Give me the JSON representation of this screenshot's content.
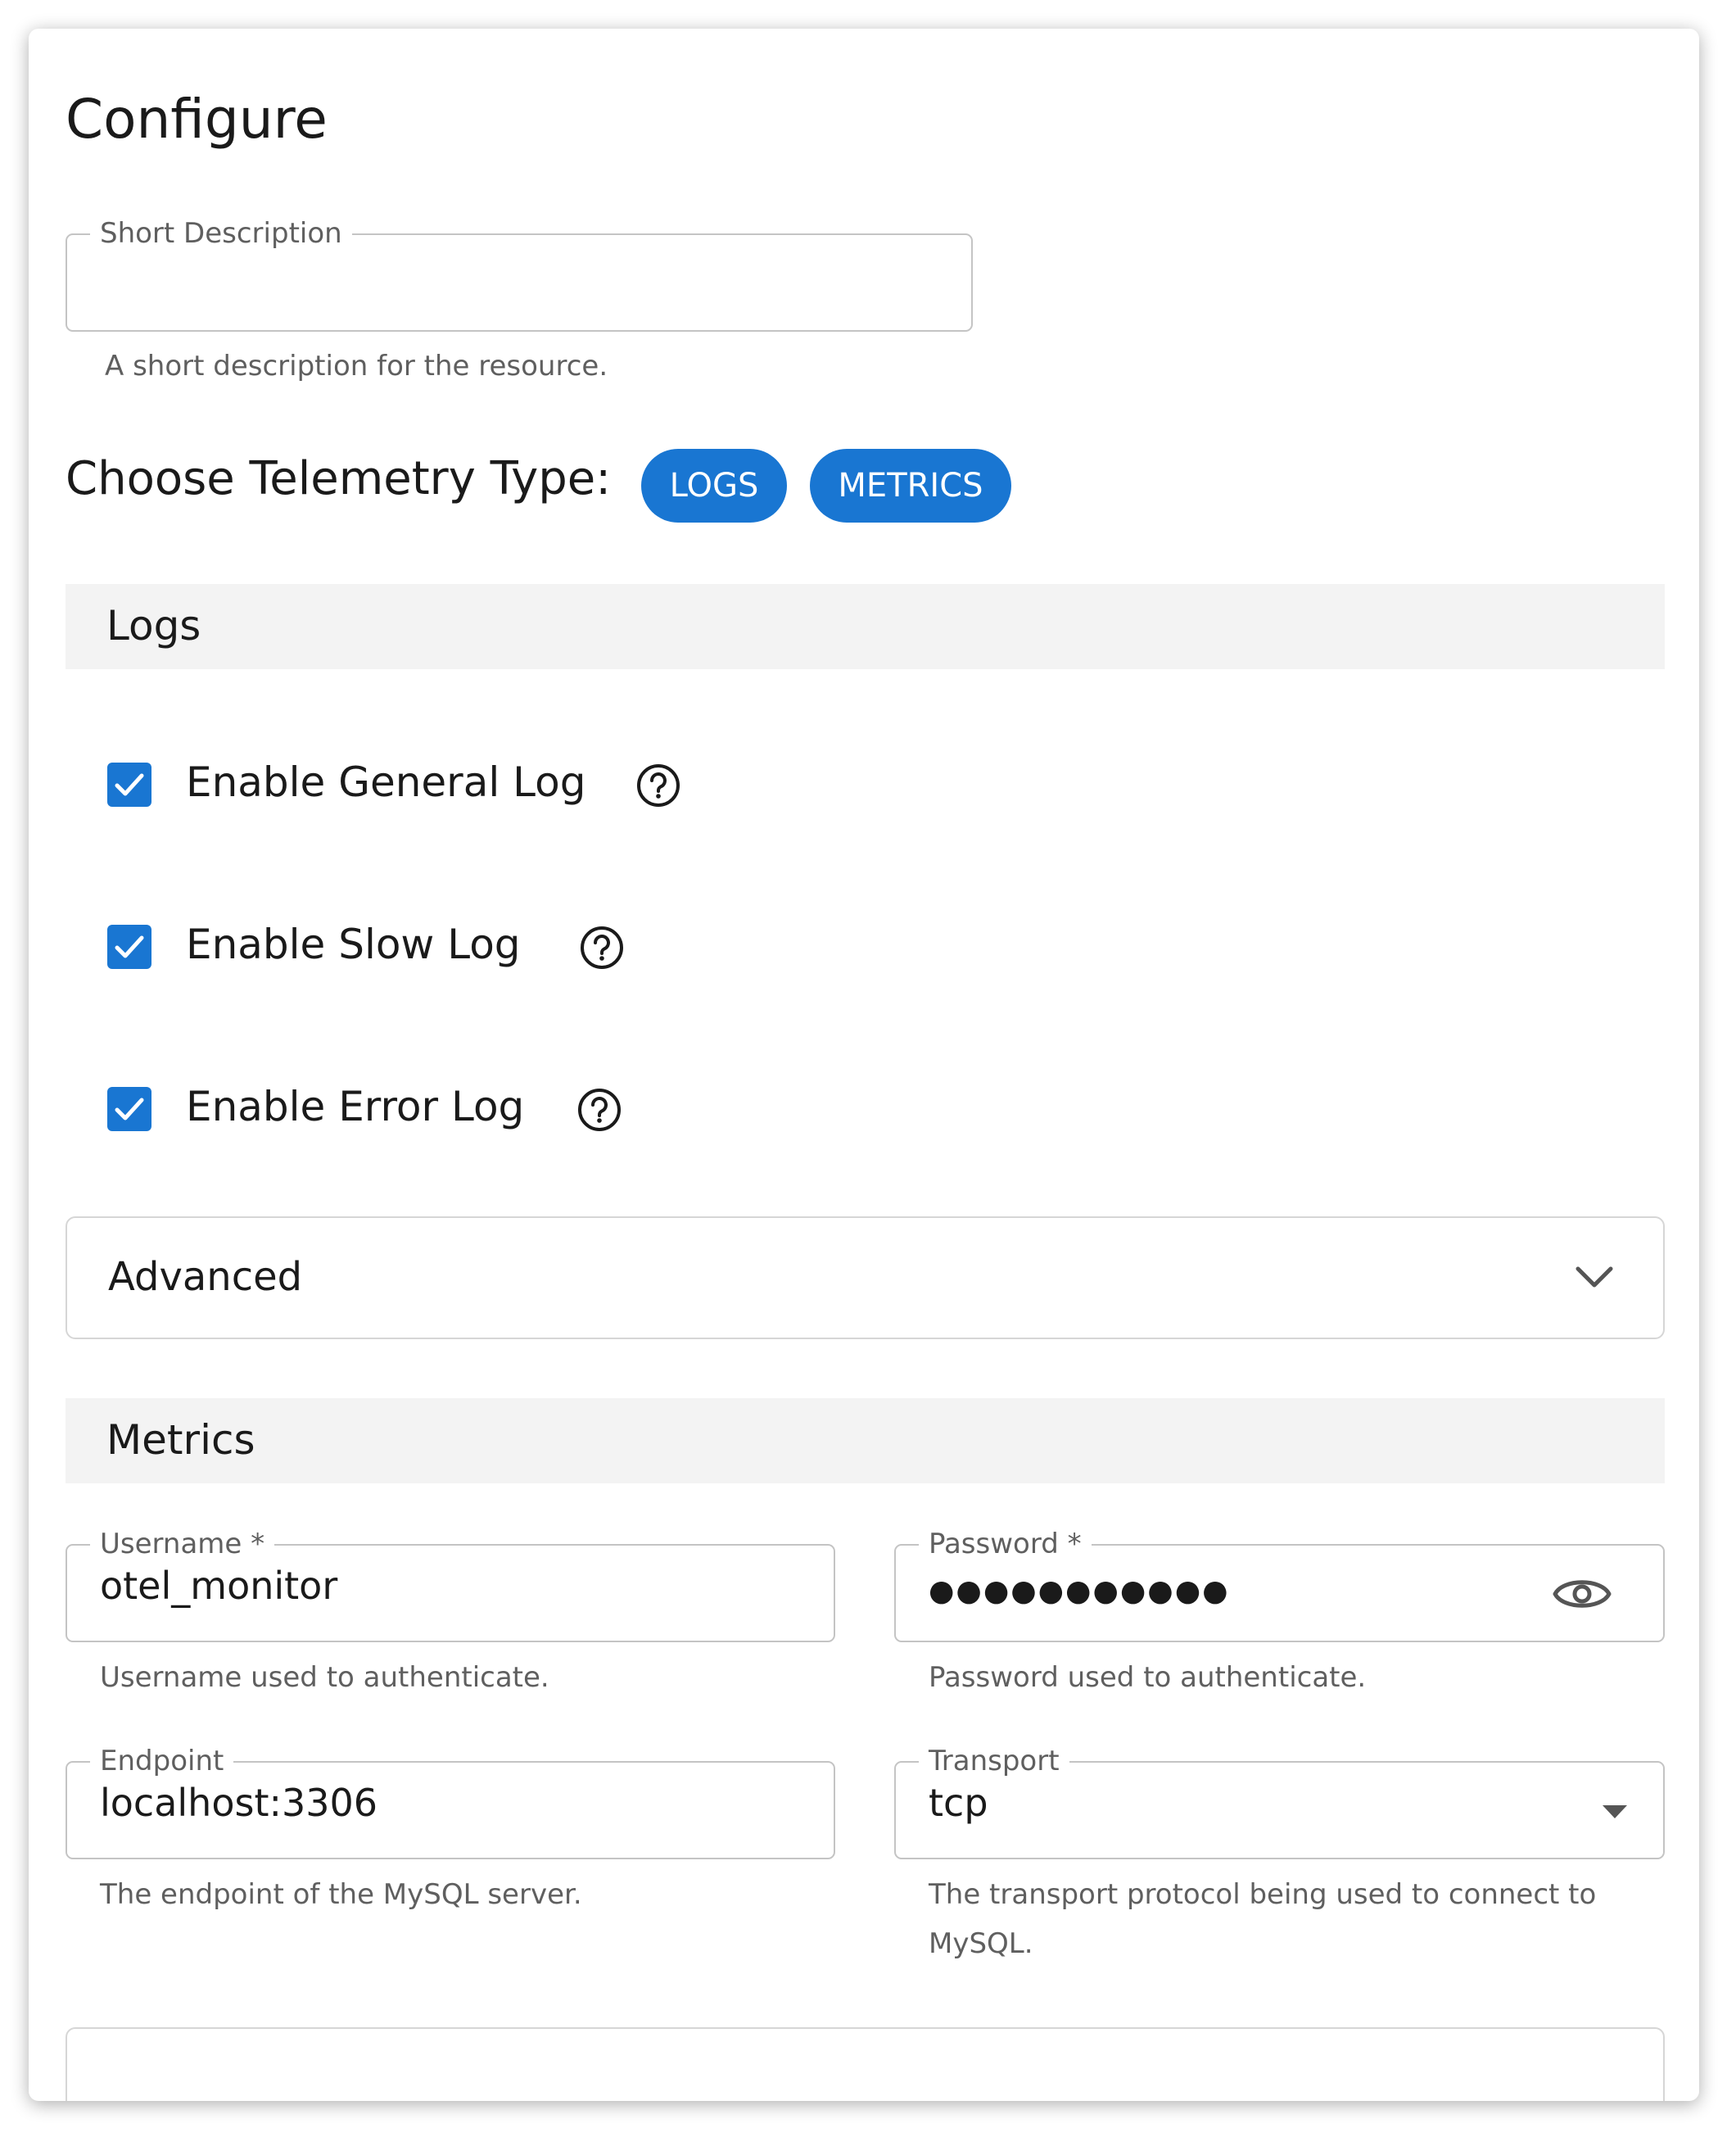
{
  "page": {
    "title": "Configure"
  },
  "short_description": {
    "label": "Short Description",
    "value": "",
    "helper": "A short description for the resource."
  },
  "telemetry": {
    "label": "Choose Telemetry Type:",
    "chips": [
      "LOGS",
      "METRICS"
    ],
    "accent_color": "#1976d2"
  },
  "logs_section": {
    "title": "Logs",
    "options": [
      {
        "label": "Enable General Log",
        "checked": true
      },
      {
        "label": "Enable Slow Log",
        "checked": true
      },
      {
        "label": "Enable Error Log",
        "checked": true
      }
    ],
    "help_icon": "help-circle-icon"
  },
  "advanced": {
    "label": "Advanced",
    "icon": "chevron-down-icon"
  },
  "metrics_section": {
    "title": "Metrics",
    "username": {
      "label": "Username *",
      "value": "otel_monitor",
      "helper": "Username used to authenticate."
    },
    "password": {
      "label": "Password *",
      "value": "●●●●●●●●●●●",
      "helper": "Password used to authenticate.",
      "icon": "eye-icon"
    },
    "endpoint": {
      "label": "Endpoint",
      "value": "localhost:3306",
      "helper": "The endpoint of the MySQL server."
    },
    "transport": {
      "label": "Transport",
      "value": "tcp",
      "helper_line1": "The transport protocol being used to connect to",
      "helper_line2": "MySQL.",
      "icon": "dropdown-arrow-icon"
    }
  }
}
